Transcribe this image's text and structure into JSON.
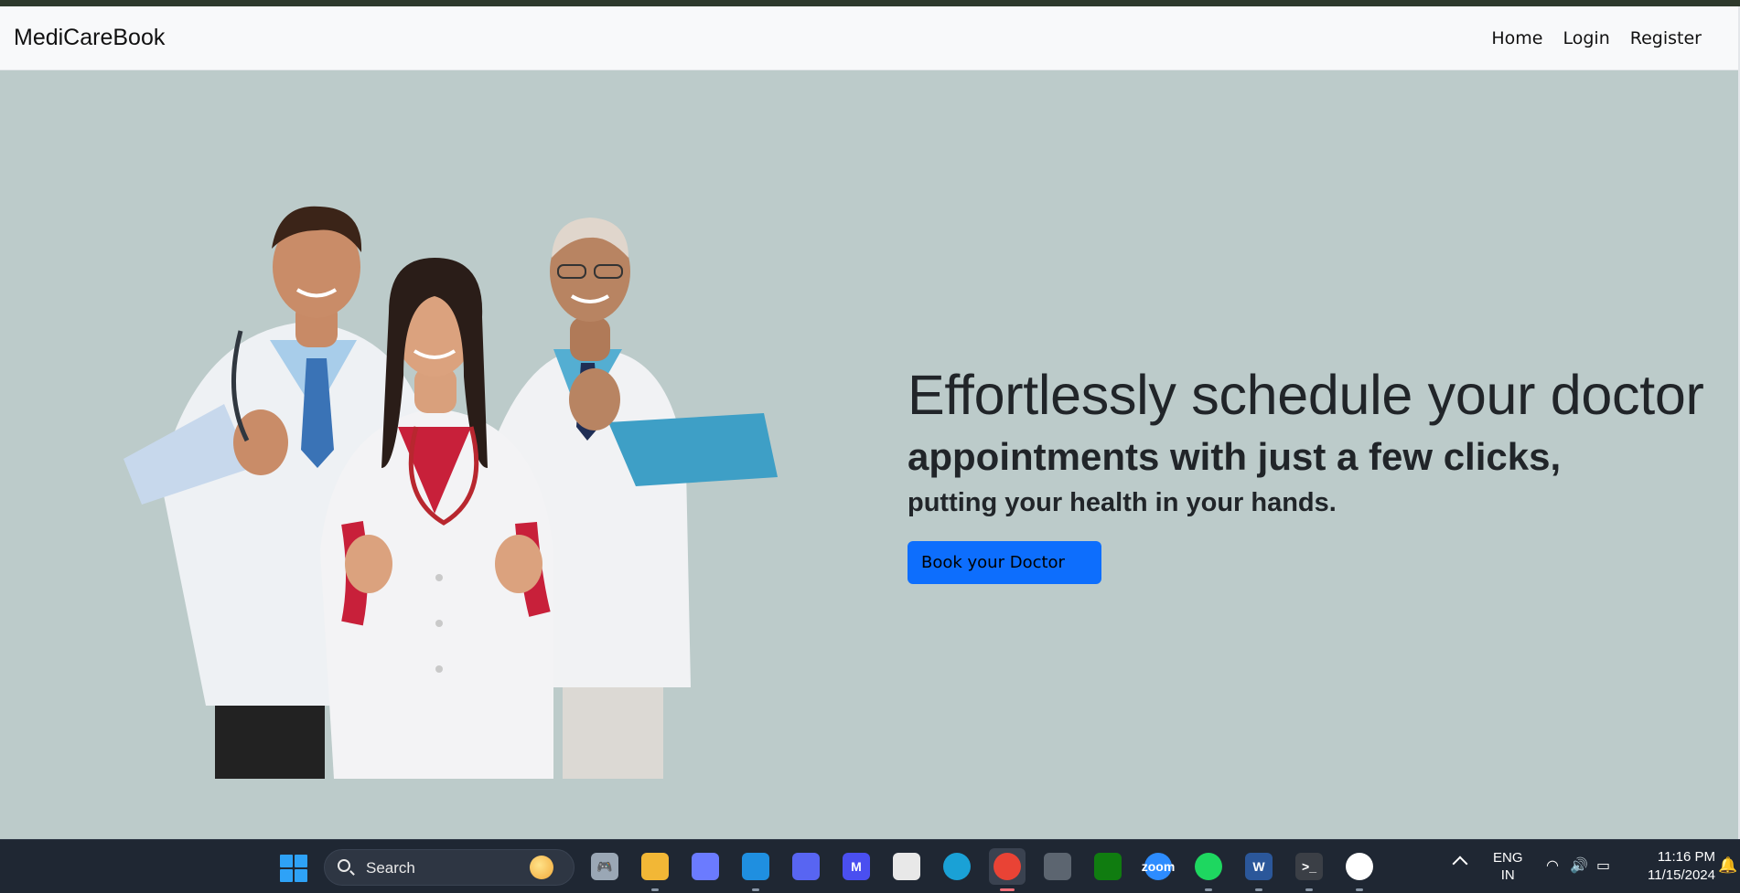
{
  "navbar": {
    "brand": "MediCareBook",
    "links": [
      "Home",
      "Login",
      "Register"
    ]
  },
  "hero": {
    "image_alt": "Three smiling doctors giving thumbs up",
    "heading_line1": "Effortlessly schedule your doctor",
    "heading_line2": "appointments with just a few clicks,",
    "heading_line3": "putting your health in your hands.",
    "cta_label": "Book your Doctor"
  },
  "taskbar": {
    "search_label": "Search",
    "apps": [
      {
        "name": "gamepad-icon",
        "color": "#9aa7b5",
        "glyph": "🎮"
      },
      {
        "name": "file-explorer-icon",
        "color": "#f2b736",
        "glyph": ""
      },
      {
        "name": "copilot-icon",
        "color": "#6b7bff",
        "glyph": ""
      },
      {
        "name": "vscode-icon",
        "color": "#1f8fe0",
        "glyph": ""
      },
      {
        "name": "discord-icon",
        "color": "#5865f2",
        "glyph": ""
      },
      {
        "name": "app-m-icon",
        "color": "#4a4ff0",
        "glyph": "M"
      },
      {
        "name": "microsoft-store-icon",
        "color": "#e8e8e8",
        "glyph": ""
      },
      {
        "name": "edge-icon",
        "color": "#1aa1d6",
        "glyph": ""
      },
      {
        "name": "chrome-icon",
        "color": "#e94335",
        "glyph": ""
      },
      {
        "name": "unity-icon",
        "color": "#5c6570",
        "glyph": ""
      },
      {
        "name": "xbox-icon",
        "color": "#107c10",
        "glyph": ""
      },
      {
        "name": "zoom-icon",
        "color": "#2d8cff",
        "glyph": "zoom"
      },
      {
        "name": "spotify-icon",
        "color": "#1ed760",
        "glyph": ""
      },
      {
        "name": "word-icon",
        "color": "#2b579a",
        "glyph": "W"
      },
      {
        "name": "terminal-icon",
        "color": "#3b3f46",
        "glyph": ">_"
      },
      {
        "name": "mongodb-icon",
        "color": "#ffffff",
        "glyph": ""
      }
    ],
    "tray": {
      "lang_line1": "ENG",
      "lang_line2": "IN",
      "time": "11:16 PM",
      "date": "11/15/2024"
    }
  }
}
